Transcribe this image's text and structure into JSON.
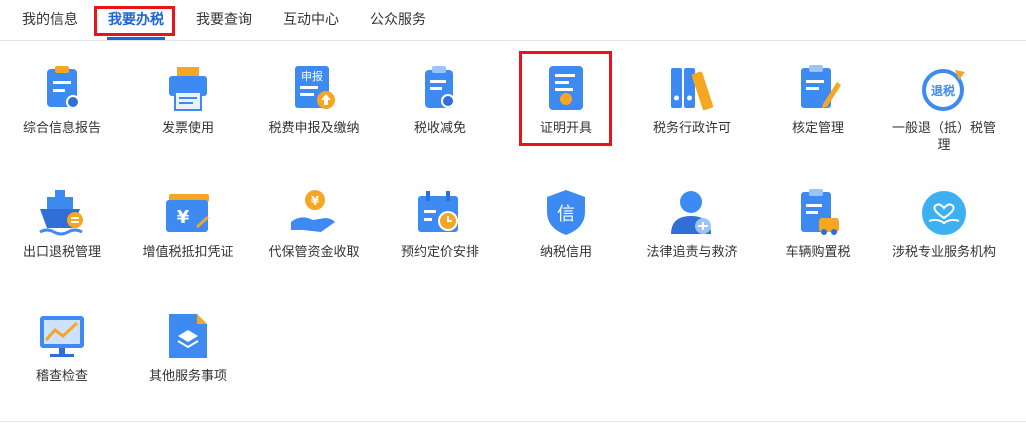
{
  "tabs": [
    {
      "label": "我的信息"
    },
    {
      "label": "我要办税"
    },
    {
      "label": "我要查询"
    },
    {
      "label": "互动中心"
    },
    {
      "label": "公众服务"
    }
  ],
  "items": [
    {
      "label": "综合信息报告",
      "icon": "report-icon"
    },
    {
      "label": "发票使用",
      "icon": "printer-icon"
    },
    {
      "label": "税费申报及缴纳",
      "icon": "declare-icon",
      "icon_text": "申报"
    },
    {
      "label": "税收减免",
      "icon": "tax-relief-icon"
    },
    {
      "label": "证明开具",
      "icon": "certificate-icon"
    },
    {
      "label": "税务行政许可",
      "icon": "binders-icon"
    },
    {
      "label": "核定管理",
      "icon": "edit-document-icon"
    },
    {
      "label": "一般退（抵）税管理",
      "icon": "refund-icon",
      "icon_text": "退税"
    },
    {
      "label": "出口退税管理",
      "icon": "ship-icon"
    },
    {
      "label": "增值税抵扣凭证",
      "icon": "voucher-icon",
      "icon_text": "¥"
    },
    {
      "label": "代保管资金收取",
      "icon": "hand-coin-icon",
      "icon_text": "¥"
    },
    {
      "label": "预约定价安排",
      "icon": "calendar-clock-icon"
    },
    {
      "label": "纳税信用",
      "icon": "credit-shield-icon",
      "icon_text": "信"
    },
    {
      "label": "法律追责与救济",
      "icon": "legal-icon"
    },
    {
      "label": "车辆购置税",
      "icon": "vehicle-tax-icon"
    },
    {
      "label": "涉税专业服务机构",
      "icon": "service-heart-icon"
    },
    {
      "label": "稽查检查",
      "icon": "monitor-chart-icon"
    },
    {
      "label": "其他服务事项",
      "icon": "layers-icon"
    }
  ],
  "colors": {
    "accent": "#1c64d8",
    "highlight": "#e8141b",
    "icon_blue": "#3d8bf2",
    "icon_orange": "#f5a623"
  }
}
